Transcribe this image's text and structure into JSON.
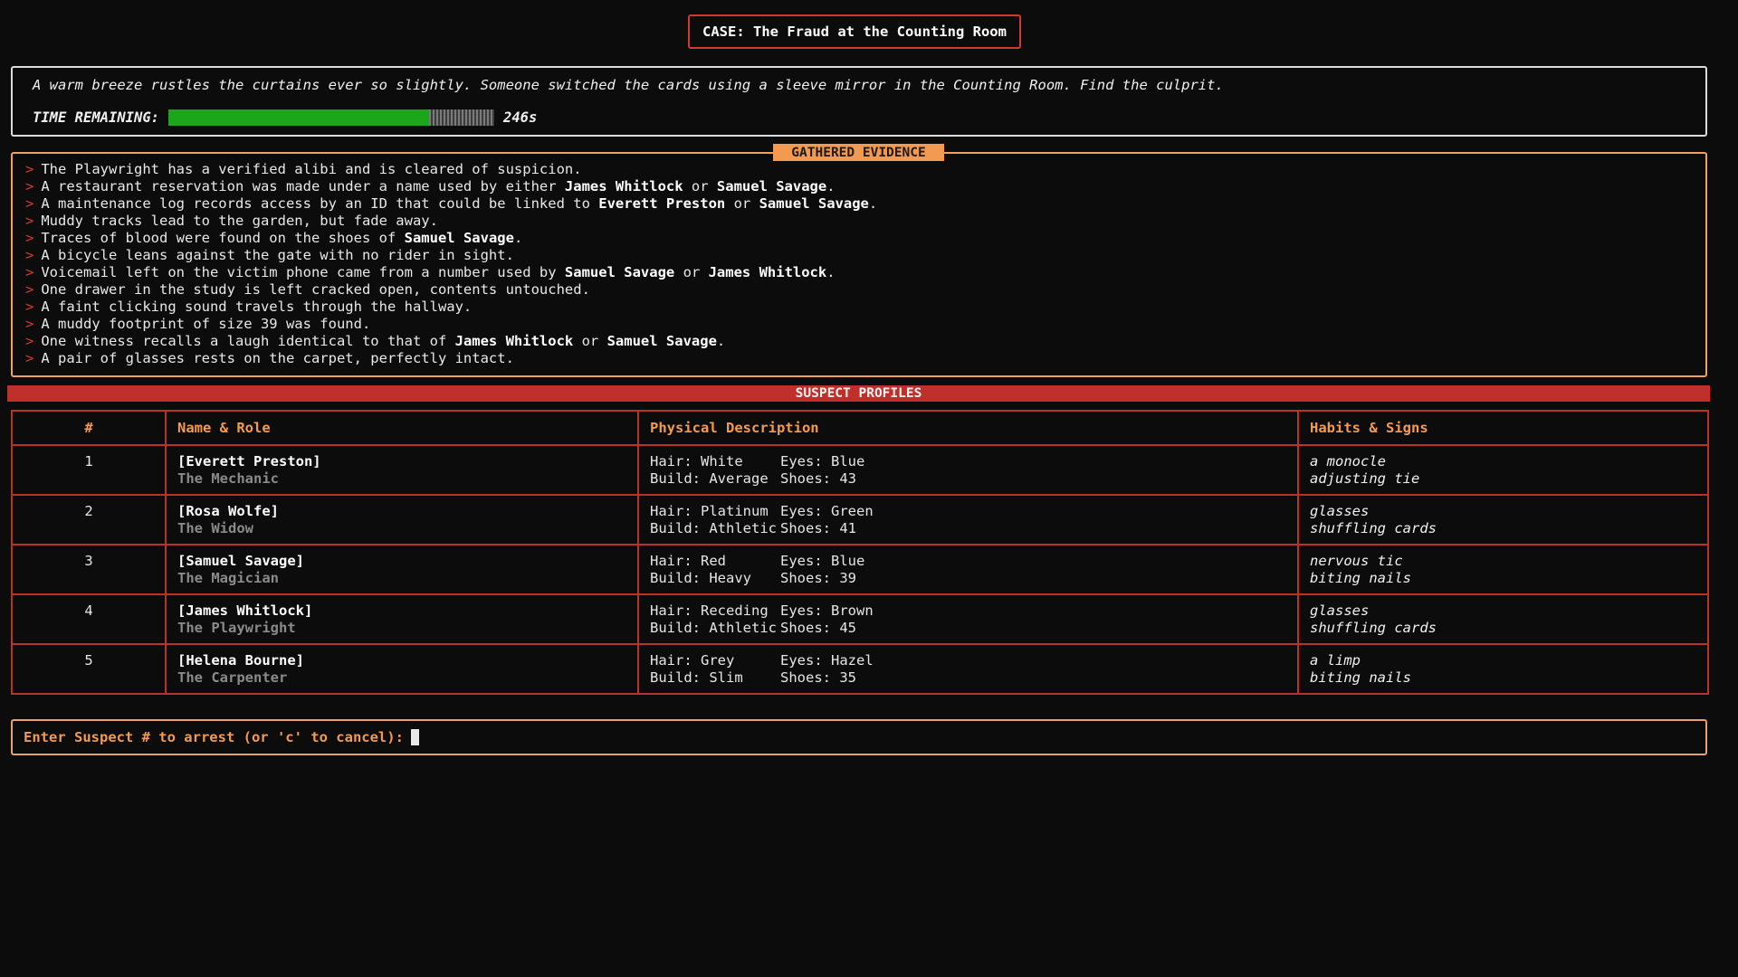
{
  "case": {
    "title": "CASE: The Fraud at the Counting Room"
  },
  "intro": {
    "text": "A warm breeze rustles the curtains ever so slightly. Someone switched the cards using a sleeve mirror in the Counting Room. Find the culprit.",
    "time_label": "TIME REMAINING:",
    "time_value": "246s",
    "time_fraction": 0.8,
    "bar_color": "#1ea51e"
  },
  "evidence": {
    "header": "GATHERED EVIDENCE",
    "arrow": ">",
    "items": [
      [
        {
          "t": "The Playwright has a verified alibi and is cleared of suspicion.",
          "b": false
        }
      ],
      [
        {
          "t": "A restaurant reservation was made under a name used by either ",
          "b": false
        },
        {
          "t": "James Whitlock",
          "b": true
        },
        {
          "t": " or ",
          "b": false
        },
        {
          "t": "Samuel Savage",
          "b": true
        },
        {
          "t": ".",
          "b": false
        }
      ],
      [
        {
          "t": "A maintenance log records access by an ID that could be linked to ",
          "b": false
        },
        {
          "t": "Everett Preston",
          "b": true
        },
        {
          "t": " or ",
          "b": false
        },
        {
          "t": "Samuel Savage",
          "b": true
        },
        {
          "t": ".",
          "b": false
        }
      ],
      [
        {
          "t": "Muddy tracks lead to the garden, but fade away.",
          "b": false
        }
      ],
      [
        {
          "t": "Traces of blood were found on the shoes of ",
          "b": false
        },
        {
          "t": "Samuel Savage",
          "b": true
        },
        {
          "t": ".",
          "b": false
        }
      ],
      [
        {
          "t": "A bicycle leans against the gate with no rider in sight.",
          "b": false
        }
      ],
      [
        {
          "t": "Voicemail left on the victim phone came from a number used by ",
          "b": false
        },
        {
          "t": "Samuel Savage",
          "b": true
        },
        {
          "t": " or ",
          "b": false
        },
        {
          "t": "James Whitlock",
          "b": true
        },
        {
          "t": ".",
          "b": false
        }
      ],
      [
        {
          "t": "One drawer in the study is left cracked open, contents untouched.",
          "b": false
        }
      ],
      [
        {
          "t": "A faint clicking sound travels through the hallway.",
          "b": false
        }
      ],
      [
        {
          "t": "A muddy footprint of size 39 was found.",
          "b": false
        }
      ],
      [
        {
          "t": "One witness recalls a laugh identical to that of ",
          "b": false
        },
        {
          "t": "James Whitlock",
          "b": true
        },
        {
          "t": " or ",
          "b": false
        },
        {
          "t": "Samuel Savage",
          "b": true
        },
        {
          "t": ".",
          "b": false
        }
      ],
      [
        {
          "t": "A pair of glasses rests on the carpet, perfectly intact.",
          "b": false
        }
      ]
    ]
  },
  "profiles": {
    "banner": "SUSPECT PROFILES",
    "columns": [
      "#",
      "Name & Role",
      "Physical Description",
      "Habits & Signs"
    ],
    "rows": [
      {
        "num": "1",
        "name": "[Everett Preston]",
        "role": "The Mechanic",
        "hair": "Hair: White",
        "eyes": "Eyes: Blue",
        "build": "Build: Average",
        "shoes": "Shoes: 43",
        "habit1": "a monocle",
        "habit2": "adjusting tie"
      },
      {
        "num": "2",
        "name": "[Rosa Wolfe]",
        "role": "The Widow",
        "hair": "Hair: Platinum",
        "eyes": "Eyes: Green",
        "build": "Build: Athletic",
        "shoes": "Shoes: 41",
        "habit1": "glasses",
        "habit2": "shuffling cards"
      },
      {
        "num": "3",
        "name": "[Samuel Savage]",
        "role": "The Magician",
        "hair": "Hair: Red",
        "eyes": "Eyes: Blue",
        "build": "Build: Heavy",
        "shoes": "Shoes: 39",
        "habit1": "nervous tic",
        "habit2": "biting nails"
      },
      {
        "num": "4",
        "name": "[James Whitlock]",
        "role": "The Playwright",
        "hair": "Hair: Receding",
        "eyes": "Eyes: Brown",
        "build": "Build: Athletic",
        "shoes": "Shoes: 45",
        "habit1": "glasses",
        "habit2": "shuffling cards"
      },
      {
        "num": "5",
        "name": "[Helena Bourne]",
        "role": "The Carpenter",
        "hair": "Hair: Grey",
        "eyes": "Eyes: Hazel",
        "build": "Build: Slim",
        "shoes": "Shoes: 35",
        "habit1": "a limp",
        "habit2": "biting nails"
      }
    ]
  },
  "prompt": {
    "label": "Enter Suspect # to arrest (or 'c' to cancel):",
    "value": ""
  }
}
